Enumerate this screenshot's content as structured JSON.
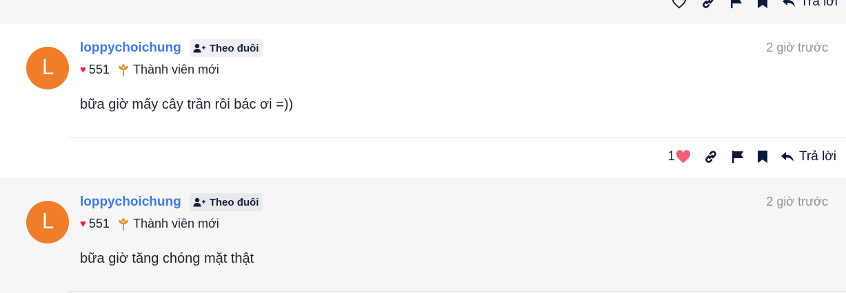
{
  "top_actions": {
    "reply_label": "Trả lời"
  },
  "posts": [
    {
      "avatar_letter": "L",
      "username": "loppychoichung",
      "follow_label": "Theo đuôi",
      "reactions": "551",
      "rank": "Thành viên mới",
      "time": "2 giờ trước",
      "content": "bữa giờ mấy cây trần rồi bác ơi =))",
      "like_count": "1",
      "reply_label": "Trả lời"
    },
    {
      "avatar_letter": "L",
      "username": "loppychoichung",
      "follow_label": "Theo đuôi",
      "reactions": "551",
      "rank": "Thành viên mới",
      "time": "2 giờ trước",
      "content": "bữa giờ tăng chóng mặt thật"
    }
  ],
  "colors": {
    "username": "#3d7be0",
    "avatar": "#ef7d2a",
    "heart_small": "#e8233f",
    "heart_like": "#f0607a",
    "icon": "#0b1a3a"
  }
}
